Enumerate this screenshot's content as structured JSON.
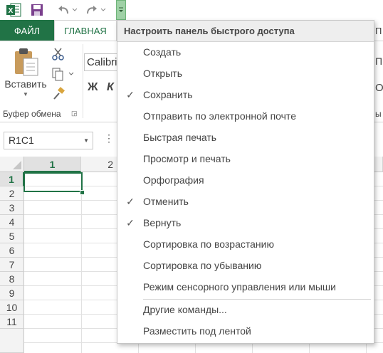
{
  "qat": {
    "excel_icon": "excel-logo-icon",
    "save_icon": "save-icon",
    "undo_icon": "undo-icon",
    "redo_icon": "redo-icon",
    "customize_icon": "qat-customize-icon"
  },
  "tabs": {
    "file": "ФАЙЛ",
    "home": "ГЛАВНАЯ",
    "right_partial": "П"
  },
  "ribbon": {
    "paste_label": "Вставить",
    "font_name": "Calibri",
    "bold": "Ж",
    "italic": "К",
    "clipboard_group": "Буфер обмена",
    "right_partial_1": "О",
    "right_partial_2": "ы"
  },
  "namebox": {
    "value": "R1C1"
  },
  "grid": {
    "columns": [
      "1",
      "2"
    ],
    "rows": [
      "1",
      "2",
      "3",
      "4",
      "5",
      "6",
      "7",
      "8",
      "9",
      "10",
      "11"
    ]
  },
  "menu": {
    "header": "Настроить панель быстрого доступа",
    "items": [
      {
        "label": "Создать",
        "checked": false
      },
      {
        "label": "Открыть",
        "checked": false
      },
      {
        "label": "Сохранить",
        "checked": true
      },
      {
        "label": "Отправить по электронной почте",
        "checked": false
      },
      {
        "label": "Быстрая печать",
        "checked": false
      },
      {
        "label": "Просмотр и печать",
        "checked": false
      },
      {
        "label": "Орфография",
        "checked": false
      },
      {
        "label": "Отменить",
        "checked": true
      },
      {
        "label": "Вернуть",
        "checked": true
      },
      {
        "label": "Сортировка по возрастанию",
        "checked": false
      },
      {
        "label": "Сортировка по убыванию",
        "checked": false
      },
      {
        "label": "Режим сенсорного управления или мыши",
        "checked": false
      }
    ],
    "more_commands": "Другие команды...",
    "show_below": "Разместить под лентой",
    "check_glyph": "✓"
  },
  "colors": {
    "excel_green": "#217346",
    "qat_dropdown_bg": "#9fd1a6",
    "active_cell_border": "#217346"
  }
}
